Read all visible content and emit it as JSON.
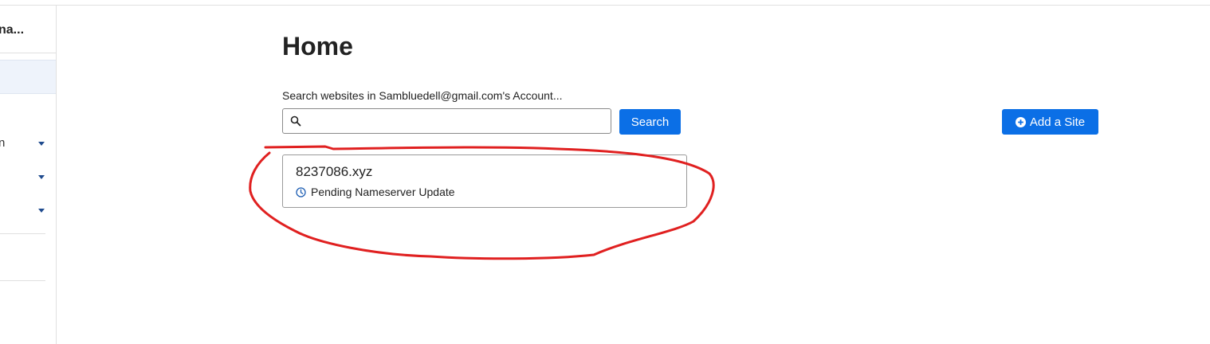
{
  "sidebar": {
    "account_name": "na...",
    "items": [
      {
        "label": "n"
      },
      {
        "label": ""
      },
      {
        "label": ""
      }
    ]
  },
  "main": {
    "title": "Home",
    "search": {
      "label": "Search websites in Sambluedell@gmail.com's Account...",
      "value": "",
      "placeholder": "",
      "button_label": "Search"
    },
    "add_site_label": "Add a Site",
    "sites": [
      {
        "domain": "8237086.xyz",
        "status": "Pending Nameserver Update"
      }
    ]
  },
  "colors": {
    "primary": "#0b6fe6",
    "annotation": "#e02020"
  }
}
